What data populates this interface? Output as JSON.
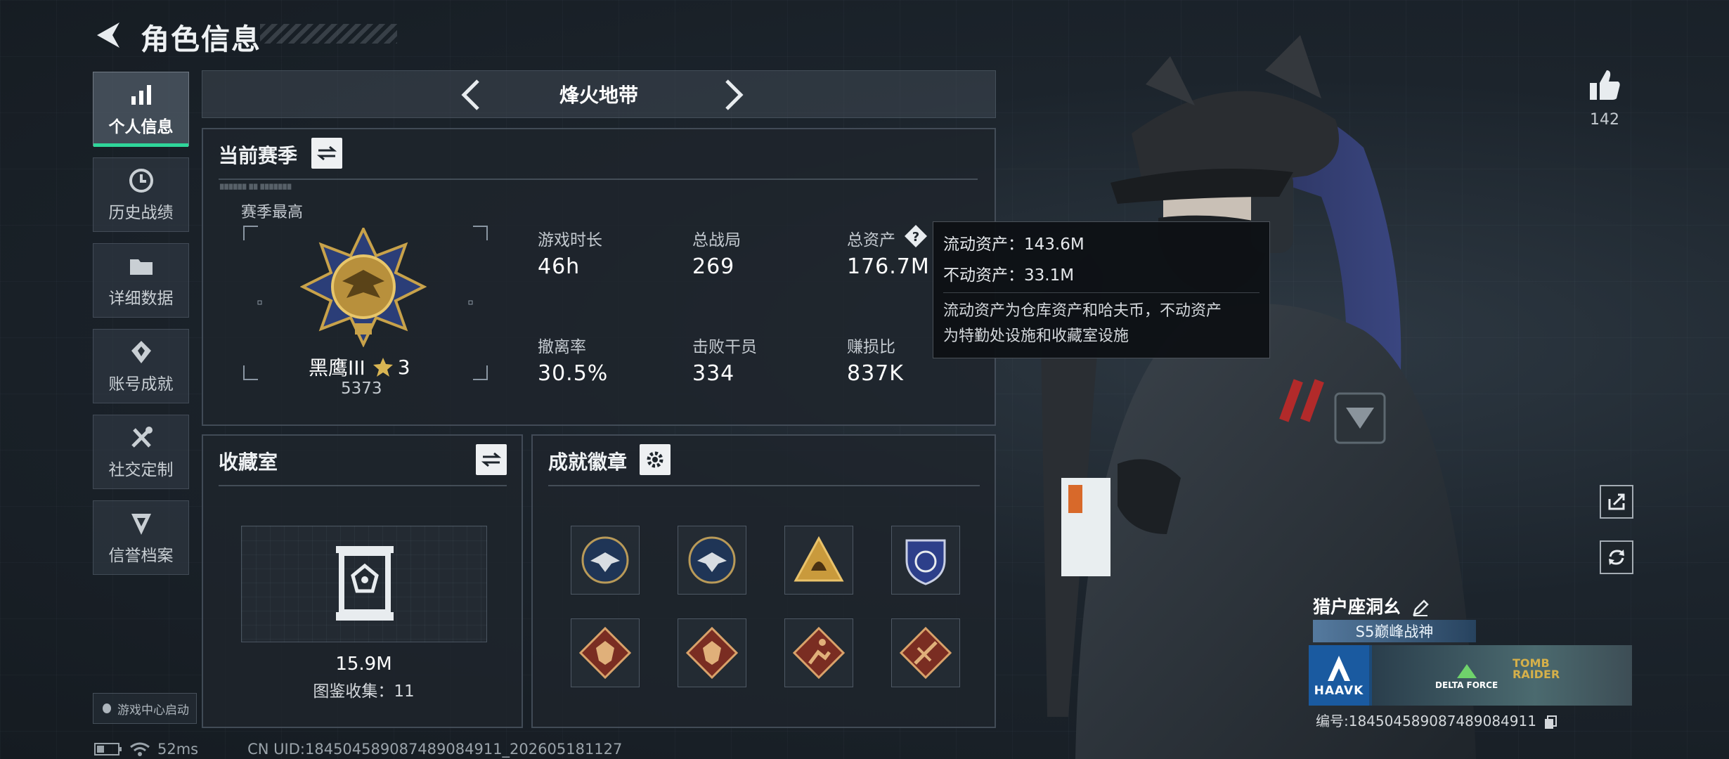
{
  "header": {
    "title": "角色信息"
  },
  "sidebar": {
    "items": [
      {
        "label": "个人信息",
        "icon": "bar-chart-icon",
        "active": true
      },
      {
        "label": "历史战绩",
        "icon": "history-icon",
        "active": false
      },
      {
        "label": "详细数据",
        "icon": "folder-icon",
        "active": false
      },
      {
        "label": "账号成就",
        "icon": "achievement-icon",
        "active": false
      },
      {
        "label": "社交定制",
        "icon": "tools-icon",
        "active": false
      },
      {
        "label": "信誉档案",
        "icon": "credit-shield-icon",
        "active": false
      }
    ],
    "game_center_label": "游戏中心启动"
  },
  "mode": {
    "title": "烽火地带"
  },
  "season": {
    "title": "当前赛季",
    "highest_label": "赛季最高",
    "rank_name": "黑鹰III",
    "rank_stars": "3",
    "rank_score": "5373",
    "stats": [
      {
        "label": "游戏时长",
        "value": "46h"
      },
      {
        "label": "总战局",
        "value": "269"
      },
      {
        "label": "总资产",
        "value": "176.7M",
        "help": true
      },
      {
        "label": "撤离率",
        "value": "30.5%"
      },
      {
        "label": "击败干员",
        "value": "334"
      },
      {
        "label": "赚损比",
        "value": "837K"
      }
    ]
  },
  "tooltip": {
    "liquid": "流动资产：143.6M",
    "fixed": "不动资产：33.1M",
    "description_line1": "流动资产为仓库资产和哈夫币，不动资产",
    "description_line2": "为特勤处设施和收藏室设施"
  },
  "collection": {
    "title": "收藏室",
    "value": "15.9M",
    "catalog": "图鉴收集：11"
  },
  "badges": {
    "title": "成就徽章",
    "items": [
      {
        "icon": "eagle-badge-icon"
      },
      {
        "icon": "eagle-badge-icon"
      },
      {
        "icon": "gold-triangle-badge-icon"
      },
      {
        "icon": "shield-badge-icon"
      },
      {
        "icon": "dragon-badge-icon"
      },
      {
        "icon": "dragon-badge-icon"
      },
      {
        "icon": "runner-badge-icon"
      },
      {
        "icon": "weapon-badge-icon"
      }
    ]
  },
  "social": {
    "likes": "142"
  },
  "player": {
    "name": "猎户座洞幺",
    "title_tag": "S5巅峰战神",
    "banner_brand": "HAAVK",
    "banner_game": "DELTA FORCE",
    "banner_collab_line1": "TOMB",
    "banner_collab_line2": "RAIDER",
    "id_text": "编号:1845045890874890849​11"
  },
  "status": {
    "ping": "52ms",
    "uid": "CN UID:1845045890874890849​11_202605181127"
  },
  "colors": {
    "accent_green": "#2fd69a",
    "panel_border": "#6e7d8c"
  }
}
